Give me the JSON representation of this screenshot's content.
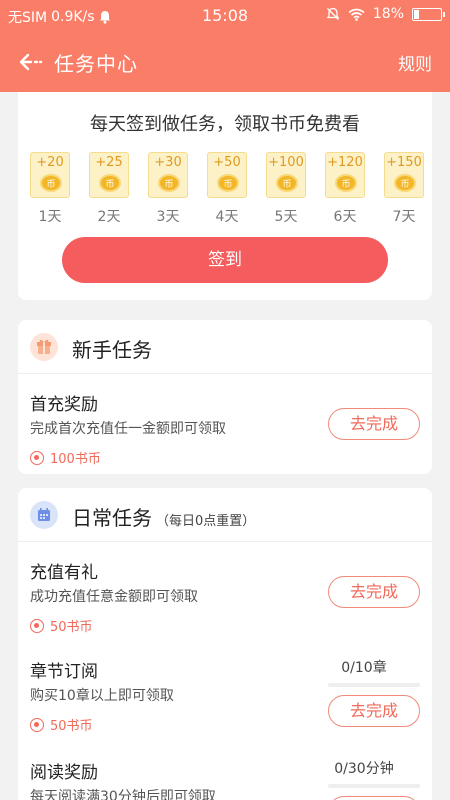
{
  "status_bar": {
    "carrier": "无SIM",
    "speed": "0.9K/s",
    "time": "15:08",
    "battery": "18%",
    "battery_level": 0.18
  },
  "nav": {
    "title": "任务中心",
    "rule_label": "规则"
  },
  "sign_in": {
    "headline": "每天签到做任务，领取书币免费看",
    "days": [
      {
        "reward": "+20",
        "label": "1天"
      },
      {
        "reward": "+25",
        "label": "2天"
      },
      {
        "reward": "+30",
        "label": "3天"
      },
      {
        "reward": "+50",
        "label": "4天"
      },
      {
        "reward": "+100",
        "label": "5天"
      },
      {
        "reward": "+120",
        "label": "6天"
      },
      {
        "reward": "+150",
        "label": "7天"
      }
    ],
    "button_label": "签到"
  },
  "newbie": {
    "title": "新手任务",
    "tasks": [
      {
        "name": "首充奖励",
        "desc": "完成首次充值任一金额即可领取",
        "reward": "100书币",
        "button": "去完成"
      }
    ]
  },
  "daily": {
    "title": "日常任务",
    "subtitle": "（每日0点重置）",
    "tasks": [
      {
        "name": "充值有礼",
        "desc": "成功充值任意金额即可领取",
        "reward": "50书币",
        "button": "去完成"
      },
      {
        "name": "章节订阅",
        "desc": "购买10章以上即可领取",
        "reward": "50书币",
        "button": "去完成",
        "progress": "0/10章",
        "progress_value": 0
      },
      {
        "name": "阅读奖励",
        "desc": "每天阅读满30分钟后即可领取",
        "progress": "0/30分钟",
        "progress_value": 0
      }
    ]
  },
  "colors": {
    "accent": "#fa7d68",
    "button": "#f45c5e",
    "reward": "#f06a5a"
  }
}
